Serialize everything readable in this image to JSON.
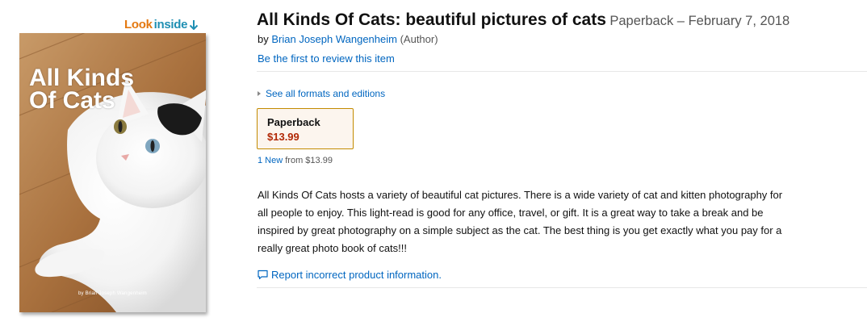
{
  "look_inside": {
    "look": "Look",
    "inside": "inside",
    "icon": "down-arrow-icon"
  },
  "cover": {
    "title": "All Kinds\nOf Cats",
    "author": "by Brian Joseph Wangenheim"
  },
  "product": {
    "title": "All Kinds Of Cats: beautiful pictures of cats",
    "format_date": "Paperback – February 7, 2018",
    "byline_prefix": "by",
    "author": "Brian Joseph Wangenheim",
    "author_role": "(Author)",
    "review_link": "Be the first to review this item"
  },
  "formats": {
    "see_all_label": "See all formats and editions",
    "selected": {
      "name": "Paperback",
      "price": "$13.99"
    },
    "offers_link": "1 New",
    "offers_from": "from $13.99"
  },
  "description": "All Kinds Of Cats hosts a variety of beautiful cat pictures. There is a wide variety of cat and kitten photography for all people to enjoy. This light-read is good for any office, travel, or gift. It is a great way to take a break and be inspired by great photography on a simple subject as the cat. The best thing is you get exactly what you pay for a really great photo book of cats!!!",
  "report": {
    "label": "Report incorrect product information.",
    "icon": "feedback-bubble-icon"
  },
  "colors": {
    "link": "#0066c0",
    "price": "#b12704",
    "look_orange": "#e47911",
    "inside_blue": "#1f8fb3",
    "selected_border": "#c38b00"
  }
}
